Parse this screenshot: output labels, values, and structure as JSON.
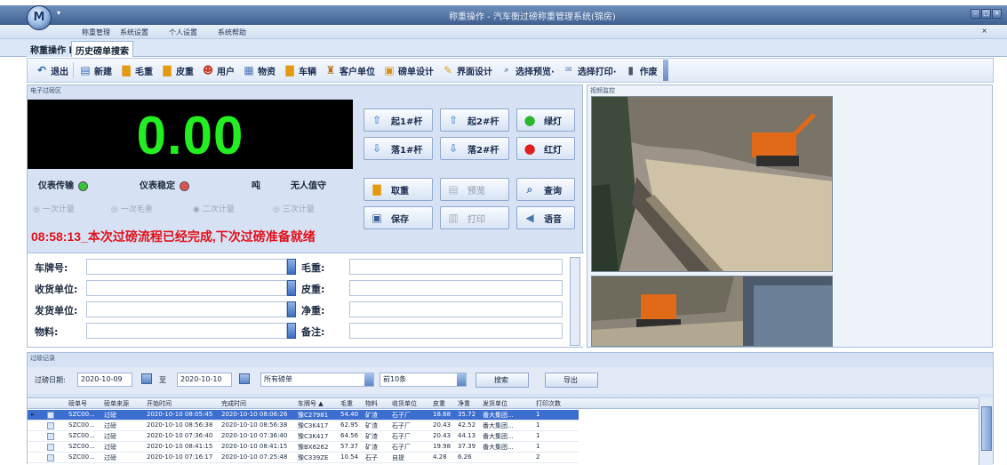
{
  "window": {
    "title": "称重操作 - 汽车衡过磅称重管理系统(锦房)",
    "app_orb": "M"
  },
  "menu": [
    "称重管理",
    "系统设置",
    "个人设置",
    "系统帮助"
  ],
  "tabs": [
    {
      "label": "称重操作"
    },
    {
      "label": "历史磅单搜索"
    }
  ],
  "toolbar": [
    {
      "label": "退出",
      "icon": "exit-icon"
    },
    {
      "label": "新建",
      "icon": "document-icon"
    },
    {
      "label": "毛重",
      "icon": "truck-icon"
    },
    {
      "label": "皮重",
      "icon": "truck-icon"
    },
    {
      "label": "用户",
      "icon": "user-icon"
    },
    {
      "label": "物资",
      "icon": "goods-icon"
    },
    {
      "label": "车辆",
      "icon": "truck-icon"
    },
    {
      "label": "客户单位",
      "icon": "customer-icon"
    },
    {
      "label": "磅单设计",
      "icon": "design-icon"
    },
    {
      "label": "界面设计",
      "icon": "brush-icon"
    },
    {
      "label": "选择预览·",
      "icon": "preview-icon"
    },
    {
      "label": "选择打印·",
      "icon": "print-icon"
    },
    {
      "label": "作废",
      "icon": "trash-icon"
    }
  ],
  "scale": {
    "group_title": "电子过磅区",
    "weight": "0.00",
    "unit": "吨",
    "meter_transmit": "仪表传输",
    "meter_stable": "仪表稳定",
    "unattended": "无人值守",
    "led_transmit_color": "#35c435",
    "led_stable_color": "#e05050",
    "modes": [
      "一次计量",
      "一次毛重",
      "二次计量",
      "三次计量"
    ],
    "notice": "08:58:13_本次过磅流程已经完成,下次过磅准备就绪"
  },
  "barrier_buttons": [
    {
      "label": "起1#杆"
    },
    {
      "label": "起2#杆"
    },
    {
      "label": "绿灯"
    },
    {
      "label": "落1#杆"
    },
    {
      "label": "落2#杆"
    },
    {
      "label": "红灯"
    }
  ],
  "action_buttons": [
    {
      "label": "取重"
    },
    {
      "label": "预览"
    },
    {
      "label": "查询"
    },
    {
      "label": "保存"
    },
    {
      "label": "打印"
    },
    {
      "label": "语音"
    }
  ],
  "form": {
    "plate": "车牌号:",
    "receiver": "收货单位:",
    "sender": "发货单位:",
    "material": "物料:",
    "gross": "毛重:",
    "tare": "皮重:",
    "net": "净重:",
    "remark": "备注:"
  },
  "video": {
    "group_title": "视频监控"
  },
  "records": {
    "group_title": "过磅记录",
    "date_label": "过磅日期:",
    "date_from": "2020-10-09",
    "to_label": "至",
    "date_to": "2020-10-10",
    "filter": "所有磅单",
    "count": "前10条",
    "search": "搜索",
    "export": "导出",
    "columns": [
      "磅单号",
      "磅单来源",
      "开始时间",
      "完成时间",
      "车牌号 ▲",
      "毛重",
      "物料",
      "收货单位",
      "皮重",
      "净重",
      "发货单位",
      "打印次数"
    ],
    "rows": [
      [
        "SZC00...",
        "过磅",
        "2020-10-10 08:05:45",
        "2020-10-10 08:06:26",
        "豫C27981",
        "54.40",
        "矿渣",
        "石子厂",
        "18.68",
        "35.72",
        "番大集团...",
        "1"
      ],
      [
        "SZC00...",
        "过磅",
        "2020-10-10 08:56:38",
        "2020-10-10 08:56:38",
        "豫C3K417",
        "62.95",
        "矿渣",
        "石子厂",
        "20.43",
        "42.52",
        "番大集团...",
        "1"
      ],
      [
        "SZC00...",
        "过磅",
        "2020-10-10 07:36:40",
        "2020-10-10 07:36:40",
        "豫C3K417",
        "64.56",
        "矿渣",
        "石子厂",
        "20.43",
        "44.13",
        "番大集团...",
        "1"
      ],
      [
        "SZC00...",
        "过磅",
        "2020-10-10 08:41:15",
        "2020-10-10 08:41:15",
        "豫BX6262",
        "57.37",
        "矿渣",
        "石子厂",
        "19.98",
        "37.39",
        "番大集团...",
        "1"
      ],
      [
        "SZC00...",
        "过磅",
        "2020-10-10 07:16:17",
        "2020-10-10 07:25:48",
        "豫C339ZE",
        "10.54",
        "石子",
        "自提",
        "4.28",
        "6.26",
        "",
        "2"
      ]
    ]
  }
}
